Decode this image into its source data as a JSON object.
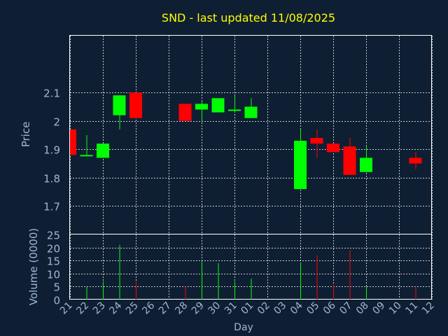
{
  "chart_data": {
    "type": "candlestick",
    "title": "SND - last updated 11/08/2025",
    "xlabel": "Day",
    "price_panel": {
      "ylabel": "Price",
      "ylim": [
        1.6,
        2.3
      ],
      "yticks": [
        1.7,
        1.8,
        1.9,
        2,
        2.1
      ],
      "ytick_labels": [
        "1.7",
        "1.8",
        "1.9",
        "2",
        "2.1"
      ]
    },
    "volume_panel": {
      "ylabel": "Volume (0000)",
      "ylim": [
        0,
        25
      ],
      "yticks": [
        0,
        5,
        10,
        15,
        20,
        25
      ],
      "ytick_labels": [
        "0",
        "5",
        "10",
        "15",
        "20",
        "25"
      ]
    },
    "x_labels": [
      "21",
      "22",
      "23",
      "24",
      "25",
      "26",
      "27",
      "28",
      "29",
      "30",
      "31",
      "01",
      "02",
      "03",
      "04",
      "05",
      "06",
      "07",
      "08",
      "09",
      "10",
      "11",
      "12"
    ],
    "grid": true,
    "colors": {
      "background": "#0f1f33",
      "up": "#00ff00",
      "down": "#ff0000",
      "title": "#ffff00",
      "text": "#9db7d6",
      "grid": "#ffffff"
    },
    "candles": [
      {
        "day": "21",
        "open": 1.97,
        "high": 1.97,
        "low": 1.88,
        "close": 1.88,
        "volume": 0
      },
      {
        "day": "22",
        "open": 1.88,
        "high": 1.95,
        "low": 1.88,
        "close": 1.88,
        "volume": 5
      },
      {
        "day": "23",
        "open": 1.87,
        "high": 1.92,
        "low": 1.87,
        "close": 1.92,
        "volume": 7
      },
      {
        "day": "24",
        "open": 2.02,
        "high": 2.09,
        "low": 1.97,
        "close": 2.09,
        "volume": 21
      },
      {
        "day": "25",
        "open": 2.1,
        "high": 2.1,
        "low": 2.01,
        "close": 2.01,
        "volume": 7
      },
      {
        "day": "28",
        "open": 2.06,
        "high": 2.06,
        "low": 2.0,
        "close": 2.0,
        "volume": 5
      },
      {
        "day": "29",
        "open": 2.04,
        "high": 2.07,
        "low": 2.0,
        "close": 2.06,
        "volume": 15
      },
      {
        "day": "30",
        "open": 2.03,
        "high": 2.08,
        "low": 2.03,
        "close": 2.08,
        "volume": 14
      },
      {
        "day": "31",
        "open": 2.04,
        "high": 2.09,
        "low": 2.03,
        "close": 2.04,
        "volume": 7
      },
      {
        "day": "01",
        "open": 2.01,
        "high": 2.08,
        "low": 2.01,
        "close": 2.05,
        "volume": 8
      },
      {
        "day": "04",
        "open": 1.76,
        "high": 1.97,
        "low": 1.76,
        "close": 1.93,
        "volume": 14
      },
      {
        "day": "05",
        "open": 1.94,
        "high": 1.97,
        "low": 1.87,
        "close": 1.92,
        "volume": 17
      },
      {
        "day": "06",
        "open": 1.92,
        "high": 1.92,
        "low": 1.89,
        "close": 1.89,
        "volume": 6
      },
      {
        "day": "07",
        "open": 1.91,
        "high": 1.94,
        "low": 1.81,
        "close": 1.81,
        "volume": 19
      },
      {
        "day": "08",
        "open": 1.82,
        "high": 1.91,
        "low": 1.82,
        "close": 1.87,
        "volume": 5
      },
      {
        "day": "11",
        "open": 1.87,
        "high": 1.89,
        "low": 1.83,
        "close": 1.85,
        "volume": 5
      }
    ]
  }
}
